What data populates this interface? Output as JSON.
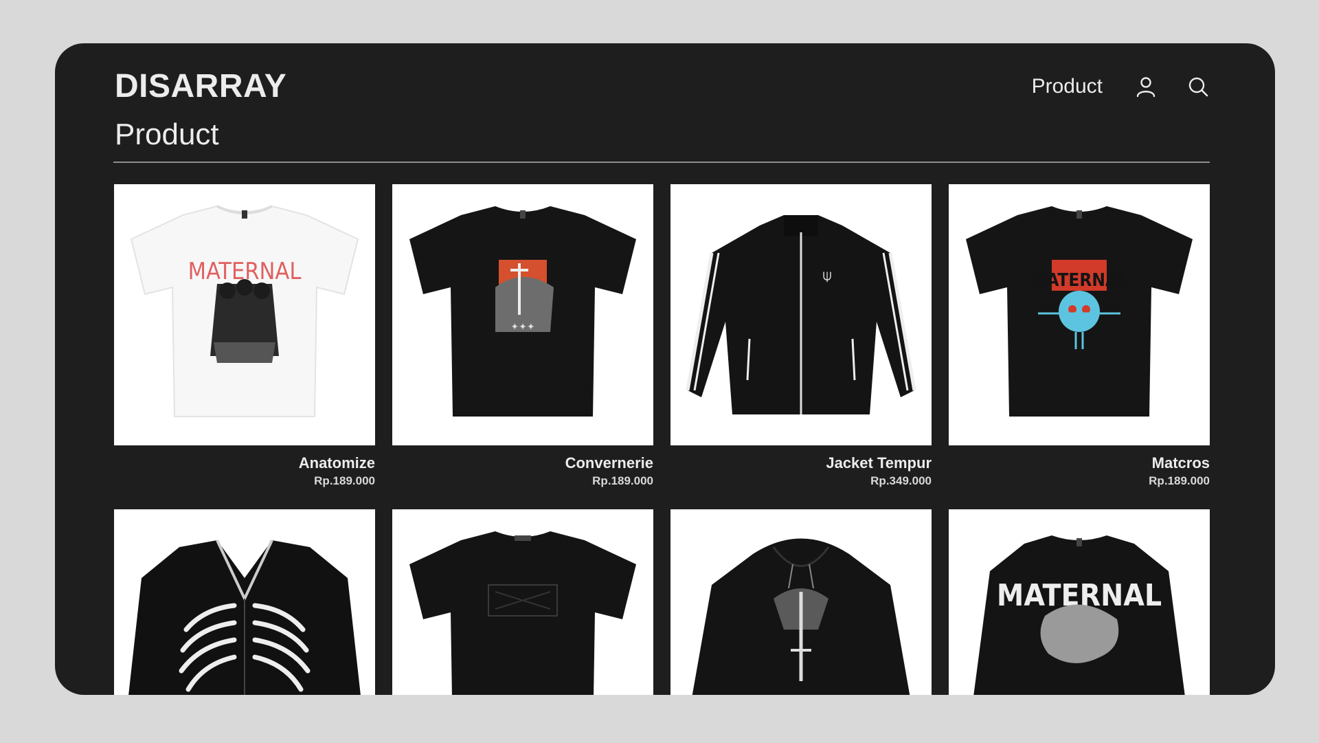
{
  "header": {
    "logo": "DISARRAY",
    "nav_product": "Product",
    "icons": [
      "user-icon",
      "search-icon"
    ]
  },
  "page": {
    "title": "Product"
  },
  "colors": {
    "background": "#d9d9d9",
    "panel": "#1e1e1e",
    "text": "#ececec",
    "card": "#ffffff"
  },
  "products": [
    {
      "name": "Anatomize",
      "price": "Rp.189.000"
    },
    {
      "name": "Convernerie",
      "price": "Rp.189.000"
    },
    {
      "name": "Jacket Tempur",
      "price": "Rp.349.000"
    },
    {
      "name": "Matcros",
      "price": "Rp.189.000"
    },
    {
      "name": "",
      "price": ""
    },
    {
      "name": "",
      "price": ""
    },
    {
      "name": "",
      "price": ""
    },
    {
      "name": "",
      "price": ""
    }
  ],
  "print_text": {
    "p1": "MATERNAL",
    "p4": "MATERNAL",
    "p8": "MATERNAL"
  }
}
